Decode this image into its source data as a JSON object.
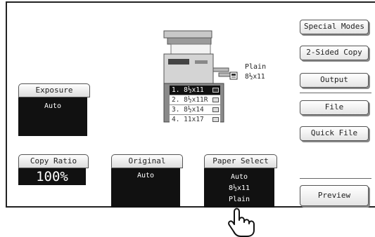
{
  "side_buttons": {
    "special_modes": "Special Modes",
    "two_sided_copy": "2-Sided Copy",
    "output": "Output",
    "file": "File",
    "quick_file": "Quick File",
    "preview": "Preview"
  },
  "exposure": {
    "label": "Exposure",
    "value": "Auto"
  },
  "copy_ratio": {
    "label": "Copy Ratio",
    "value": "100%"
  },
  "original": {
    "label": "Original",
    "value": "Auto"
  },
  "paper_select": {
    "label": "Paper Select",
    "mode": "Auto",
    "size": "8½x11",
    "type": "Plain"
  },
  "bypass": {
    "type": "Plain",
    "size": "8½x11"
  },
  "trays": [
    {
      "label": "1. 8½x11",
      "selected": true
    },
    {
      "label": "2. 8½x11R",
      "selected": false
    },
    {
      "label": "3. 8½x14",
      "selected": false
    },
    {
      "label": "4. 11x17",
      "selected": false
    }
  ]
}
